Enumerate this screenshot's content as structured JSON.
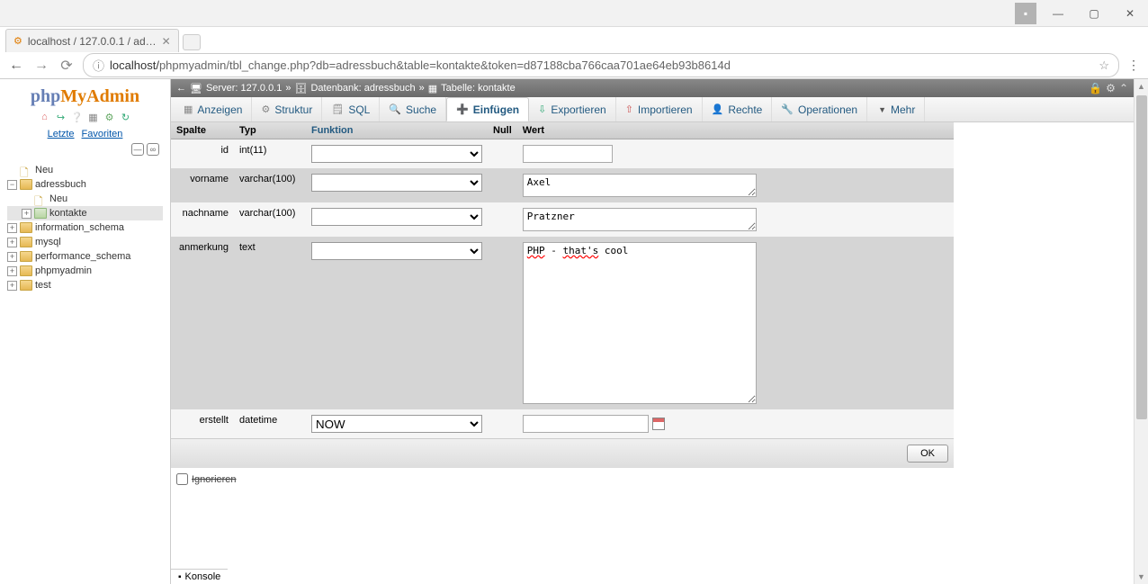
{
  "browser": {
    "tab_title": "localhost / 127.0.0.1 / ad…",
    "url_prefix": "localhost/",
    "url_rest": "phpmyadmin/tbl_change.php?db=adressbuch&table=kontakte&token=d87188cba766caa701ae64eb93b8614d",
    "info_icon": "ⓘ"
  },
  "logo": {
    "php": "php",
    "my": "My",
    "admin": "Admin"
  },
  "side_tabs": {
    "recent": "Letzte",
    "fav": "Favoriten"
  },
  "tree": {
    "neu": "Neu",
    "adressbuch": "adressbuch",
    "adr_neu": "Neu",
    "kontakte": "kontakte",
    "info": "information_schema",
    "mysql": "mysql",
    "perf": "performance_schema",
    "pma": "phpmyadmin",
    "test": "test"
  },
  "breadcrumb": {
    "server_lbl": "Server: 127.0.0.1",
    "db_lbl": "Datenbank: adressbuch",
    "table_lbl": "Tabelle: kontakte",
    "sep": "»"
  },
  "tabs": {
    "anzeigen": "Anzeigen",
    "struktur": "Struktur",
    "sql": "SQL",
    "suche": "Suche",
    "einfuegen": "Einfügen",
    "export": "Exportieren",
    "import": "Importieren",
    "rechte": "Rechte",
    "op": "Operationen",
    "mehr": "Mehr"
  },
  "table": {
    "h_spalte": "Spalte",
    "h_typ": "Typ",
    "h_funktion": "Funktion",
    "h_null": "Null",
    "h_wert": "Wert",
    "rows": [
      {
        "name": "id",
        "type": "int(11)",
        "func": "",
        "val": "",
        "input": "text"
      },
      {
        "name": "vorname",
        "type": "varchar(100)",
        "func": "",
        "val": "Axel",
        "input": "textarea-sm"
      },
      {
        "name": "nachname",
        "type": "varchar(100)",
        "func": "",
        "val": "Pratzner",
        "input": "textarea-sm"
      },
      {
        "name": "anmerkung",
        "type": "text",
        "func": "",
        "val_html": "<span class='redund'>PHP</span> - <span class='redund'>that's</span> cool",
        "input": "textarea-lg"
      },
      {
        "name": "erstellt",
        "type": "datetime",
        "func": "NOW",
        "val": "",
        "input": "text-cal"
      }
    ]
  },
  "ok": "OK",
  "ignore": "Ignorieren",
  "konsole": "Konsole"
}
